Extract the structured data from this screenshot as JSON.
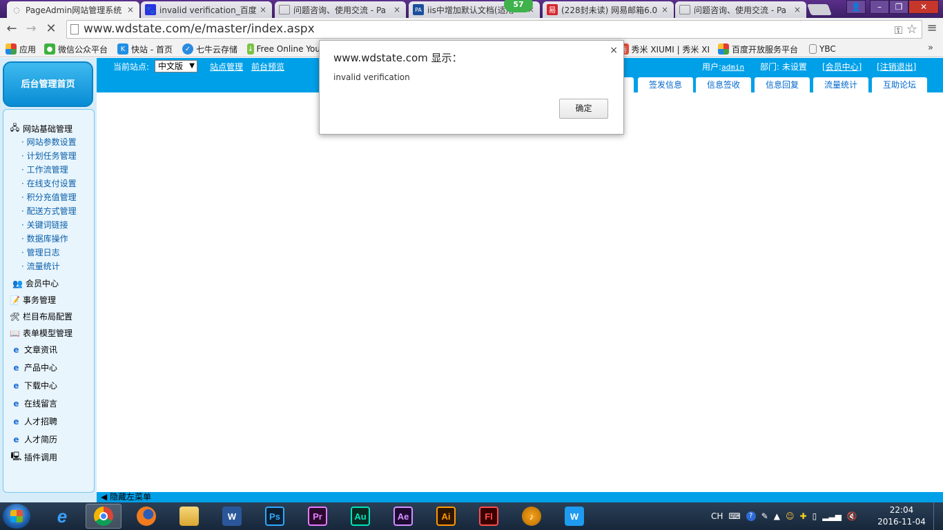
{
  "browser": {
    "tabs": [
      {
        "title": "PageAdmin网站管理系统",
        "favicon": "loading-spinner",
        "active": true
      },
      {
        "title": "invalid verification_百度",
        "favicon": "baidu-paw"
      },
      {
        "title": "问题咨询、使用交流 - Pa",
        "favicon": "page"
      },
      {
        "title": "iis中增加默认文档(适用",
        "favicon": "pa-logo"
      },
      {
        "title": "(228封未读) 网易邮箱6.0",
        "favicon": "netease-mail"
      },
      {
        "title": "问题咨询、使用交流 - Pa",
        "favicon": "page"
      }
    ],
    "tab_close": "×",
    "badge": "57",
    "window_controls": {
      "minimize": "–",
      "restore": "❐",
      "close": "✕",
      "user": "👤"
    },
    "url": "www.wdstate.com/e/master/index.aspx",
    "bookmarks": [
      {
        "label": "应用",
        "icon": "apps-grid"
      },
      {
        "label": "微信公众平台",
        "icon": "wechat"
      },
      {
        "label": "快站 - 首页",
        "icon": "kuaizhan"
      },
      {
        "label": "七牛云存储",
        "icon": "qiniu"
      },
      {
        "label": "Free Online You",
        "icon": "download-arrow"
      },
      {
        "label": "秀米 XIUMI | 秀米 XI",
        "icon": "xiumi"
      },
      {
        "label": "百度开放服务平台",
        "icon": "baidu-open"
      },
      {
        "label": "YBC",
        "icon": "page"
      }
    ],
    "bookmarks_more": "»"
  },
  "admin": {
    "home_button": "后台管理首页",
    "current_site_label": "当前站点:",
    "site_select": "中文版",
    "site_manage": "站点管理",
    "front_preview": "前台预览",
    "user_label": "用户:",
    "user_name": "admin",
    "department": "部门: 未设置",
    "member_center": "[会员中心]",
    "logout": "[注销退出]",
    "top_tabs": [
      "签发信息",
      "信息签收",
      "信息回复",
      "流量统计",
      "互助论坛"
    ],
    "menu": {
      "group1": "网站基础管理",
      "group1_items": [
        "网站参数设置",
        "计划任务管理",
        "工作流管理",
        "在线支付设置",
        "积分充值管理",
        "配送方式管理",
        "关键词链接",
        "数据库操作",
        "管理日志",
        "流量统计"
      ],
      "groups": [
        "会员中心",
        "事务管理",
        "栏目布局配置",
        "表单模型管理",
        "文章资讯",
        "产品中心",
        "下载中心",
        "在线留言",
        "人才招聘",
        "人才简历",
        "插件调用"
      ]
    },
    "hide_menu": "◀ 隐藏左菜单"
  },
  "dialog": {
    "title": "www.wdstate.com 显示：",
    "message": "invalid verification",
    "ok": "确定",
    "close": "×"
  },
  "taskbar": {
    "apps": [
      "Internet Explorer",
      "Chrome",
      "Firefox",
      "Explorer",
      "Word",
      "Ps",
      "Pr",
      "Au",
      "Ae",
      "Ai",
      "Fl",
      "FL Studio",
      "W"
    ],
    "tray_lang": "CH",
    "time": "22:04",
    "date": "2016-11-04"
  },
  "colors": {
    "accent_blue": "#00a0e9",
    "panel_bg": "#d6edf9",
    "tab_strip": "#5a2f8a"
  }
}
